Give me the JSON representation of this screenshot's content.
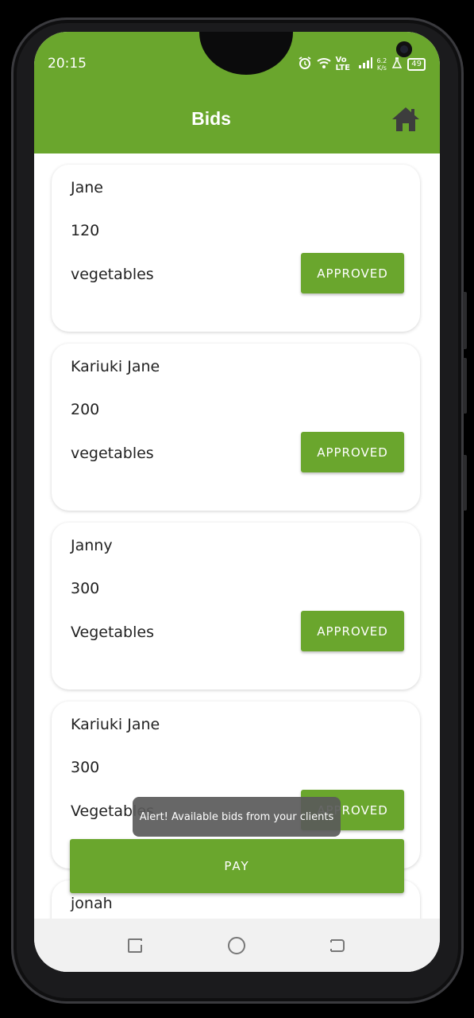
{
  "status_bar": {
    "time": "20:15",
    "network_label": "Vo LTE",
    "speed_value": "6.2",
    "speed_unit": "K/s",
    "battery": "49"
  },
  "appbar": {
    "title": "Bids",
    "home_icon": "home-icon"
  },
  "bids": [
    {
      "name": "Jane",
      "amount": "120",
      "product": "vegetables",
      "status": "APPROVED"
    },
    {
      "name": "Kariuki Jane",
      "amount": "200",
      "product": "vegetables",
      "status": "APPROVED"
    },
    {
      "name": "Janny",
      "amount": "300",
      "product": "Vegetables",
      "status": "APPROVED"
    },
    {
      "name": "Kariuki Jane",
      "amount": "300",
      "product": "Vegetables",
      "status": "APPROVED"
    },
    {
      "name": "jonah",
      "amount": "",
      "product": "",
      "status": ""
    }
  ],
  "pay_button": "PAY",
  "toast": "Alert! Available bids from your clients",
  "colors": {
    "primary": "#6aa62d",
    "card_bg": "#ffffff",
    "toast_bg": "#5a5a5a"
  }
}
